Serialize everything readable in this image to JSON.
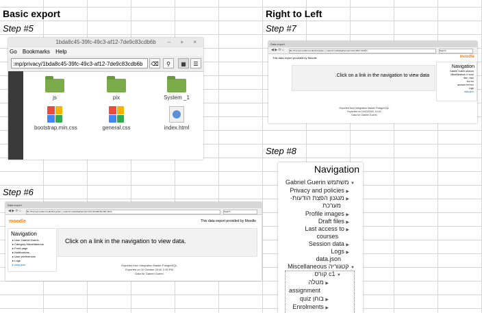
{
  "headings": {
    "basic_export": "Basic export",
    "rtl": "Right to Left",
    "step5": "Step #5",
    "step6": "Step #6",
    "step7": "Step #7",
    "step8": "Step #8"
  },
  "file_manager": {
    "title": "1bda8c45-39fc-49c3-af12-7de9c83cdb6b",
    "window_controls": "– + ×",
    "menu": [
      "Go",
      "Bookmarks",
      "Help"
    ],
    "path": ":mp/privacy/1bda8c45-39fc-49c3-af12-7de9c83cdb6b",
    "items": [
      {
        "name": "js",
        "kind": "folder"
      },
      {
        "name": "pix",
        "kind": "folder"
      },
      {
        "name": "System _1",
        "kind": "folder"
      },
      {
        "name": "bootstrap.min.css",
        "kind": "css"
      },
      {
        "name": "general.css",
        "kind": "css"
      },
      {
        "name": "index.html",
        "kind": "html"
      }
    ]
  },
  "step6": {
    "tab": "Data export",
    "url": "file:///home/moodle/moodle/integration_master/moodledata/temp/privacy/1bda8c45-39fc-49c3-",
    "search": "Search",
    "logo": "moodle",
    "provided_by": "This data export provided by Moodle",
    "nav_title": "Navigation",
    "nav_items": [
      "User Gabriel Guerin",
      "Category Miscellaneous",
      "Front page",
      "Notifications",
      "User preferences",
      "Logs",
      "data.json"
    ],
    "main_text": "Click on a link in the navigation to view data.",
    "footer": [
      "Exported from Integration Master PostgreSQL",
      "Exported on 10 October 2018, 2:30 PM",
      "Data for Gabriel Guerin"
    ]
  },
  "step7": {
    "tab": "Data export",
    "url": "file:///home/moodle/moodle/integration_master/moodledata/temp/privacy/2007-4bc8-b",
    "search": "Search",
    "logo": "moodle",
    "provided_by": "This data export provided by Moodle",
    "nav_title": "Navigation",
    "nav_items": [
      "Gabriel Guerin משתמש",
      "Miscellaneous קטגוריה",
      "עמוד ראשי",
      "הודעות",
      "העדפות משתמש",
      "Logs",
      "data.json"
    ],
    "main_text": ".Click on a link in the navigation to view data",
    "footer": [
      "Exported from Integration Master PostgreSQL",
      "Exported on 10/10/2018, 14:43",
      "Data for Gabriel Guerin"
    ]
  },
  "step8": {
    "title": "Navigation",
    "items": [
      "Gabriel Guerin משתמש",
      "Privacy and policies",
      "-מנגנון הפצת הודעות",
      "מערכת",
      "Profile images",
      "Draft files",
      "Last access to",
      "courses",
      "Session data",
      "Logs",
      "data.json",
      "Miscellaneous קטגוריה",
      "קורס c1",
      "מטלה",
      "assignment",
      "quiz בוחן",
      "Enrolments"
    ]
  },
  "colors": {
    "moodle_orange": "#f98012",
    "link_blue": "#0f6cbf",
    "folder_green": "#7cab4a"
  }
}
